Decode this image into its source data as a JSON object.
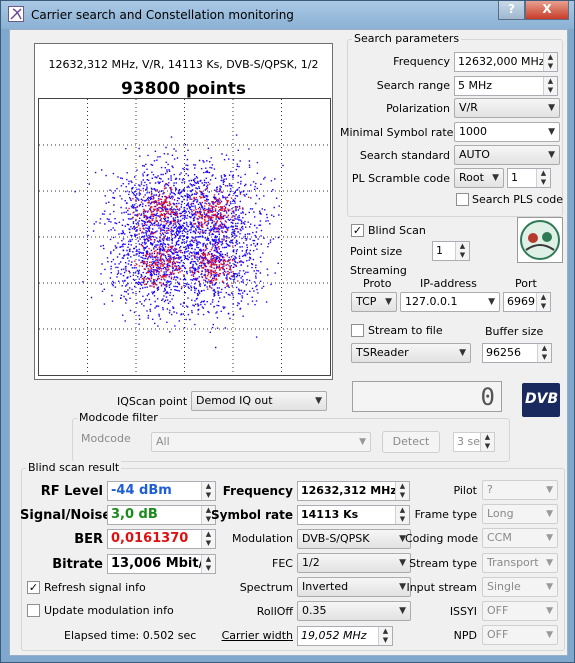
{
  "window": {
    "title": "Carrier search and Constellation monitoring",
    "help_btn": "?",
    "close_btn": "X"
  },
  "plot": {
    "info": "12632,312 MHz, V/R, 14113 Ks, DVB-S/QPSK, 1/2",
    "points": "93800 points"
  },
  "search": {
    "title": "Search parameters",
    "frequency_label": "Frequency",
    "frequency_value": "12632,000 MHz",
    "range_label": "Search range",
    "range_value": "5 MHz",
    "polarization_label": "Polarization",
    "polarization_value": "V/R",
    "min_sr_label": "Minimal Symbol rate",
    "min_sr_value": "1000",
    "standard_label": "Search standard",
    "standard_value": "AUTO",
    "pl_label": "PL Scramble code",
    "pl_mode": "Root",
    "pl_value": "1",
    "pls_label": "Search PLS code"
  },
  "blind_scan": {
    "label": "Blind Scan",
    "checked": "✓",
    "point_size_label": "Point size",
    "point_size_value": "1"
  },
  "streaming": {
    "title": "Streaming",
    "proto_label": "Proto",
    "ip_label": "IP-address",
    "port_label": "Port",
    "proto_value": "TCP",
    "ip_value": "127.0.0.1",
    "port_value": "6969",
    "stream_to_file_label": "Stream to file",
    "buffer_label": "Buffer size",
    "reader_value": "TSReader",
    "buffer_value": "96256"
  },
  "display_value": "0",
  "logo_text": "DVB",
  "iq": {
    "label": "IQScan point",
    "value": "Demod IQ out"
  },
  "modcode": {
    "title": "Modcode filter",
    "label": "Modcode",
    "value": "All",
    "detect_label": "Detect",
    "time_value": "3 sec"
  },
  "result": {
    "title": "Blind scan result",
    "rf_label": "RF Level",
    "rf_value": "-44 dBm",
    "sn_label": "Signal/Noise",
    "sn_value": "3,0 dB",
    "ber_label": "BER",
    "ber_value": "0,0161370",
    "bitrate_label": "Bitrate",
    "bitrate_value": "13,006 Mbit/s",
    "refresh_label": "Refresh signal info",
    "refresh_check": "✓",
    "update_label": "Update modulation info",
    "elapsed": "Elapsed time: 0.502 sec",
    "freq_label": "Frequency",
    "freq_value": "12632,312 MHz",
    "sr_label": "Symbol rate",
    "sr_value": "14113 Ks",
    "mod_label": "Modulation",
    "mod_value": "DVB-S/QPSK",
    "fec_label": "FEC",
    "fec_value": "1/2",
    "spectrum_label": "Spectrum",
    "spectrum_value": "Inverted",
    "rolloff_label": "RollOff",
    "rolloff_value": "0.35",
    "cw_label": "Carrier width",
    "cw_value": "19,052 MHz",
    "pilot_label": "Pilot",
    "pilot_value": "?",
    "frame_label": "Frame type",
    "frame_value": "Long",
    "coding_label": "Coding mode",
    "coding_value": "CCM",
    "stype_label": "Stream type",
    "stype_value": "Transport",
    "istream_label": "Input stream",
    "istream_value": "Single",
    "issyi_label": "ISSYI",
    "issyi_value": "OFF",
    "npd_label": "NPD",
    "npd_value": "OFF"
  },
  "colors": {
    "rf": "#1f5fd6",
    "sn": "#1a8a1a",
    "ber": "#e01010",
    "scatter_blue": "#1a00ff",
    "scatter_red": "#e0102a",
    "title_bar": "#8bb1d4"
  }
}
